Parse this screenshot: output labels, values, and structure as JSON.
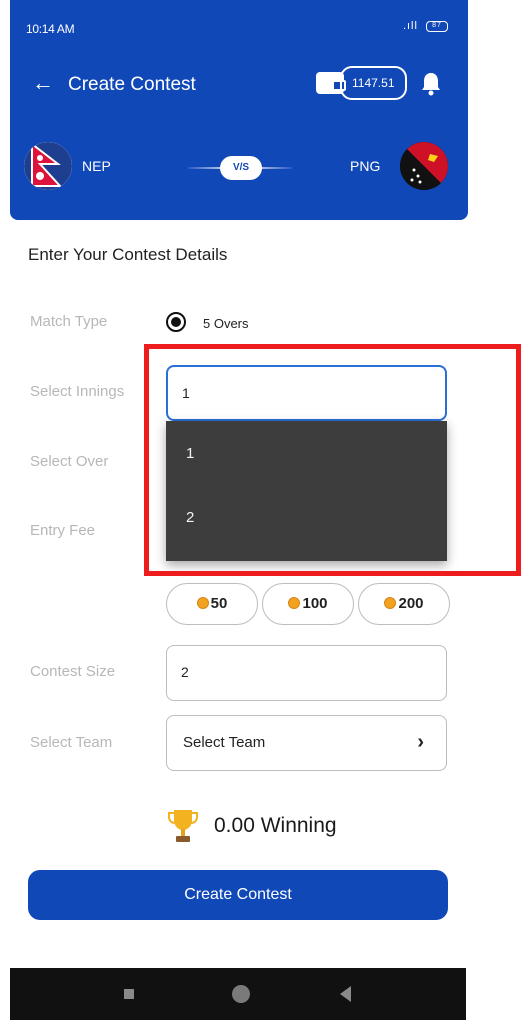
{
  "status_bar": {
    "time": "10:14 AM",
    "signal": ".ıll",
    "battery": "87"
  },
  "header": {
    "title": "Create Contest",
    "wallet_balance": "1147.51",
    "home_team": "NEP",
    "away_team": "PNG",
    "versus": "V/S"
  },
  "form": {
    "section_title": "Enter Your Contest Details",
    "labels": {
      "match_type": "Match Type",
      "select_innings": "Select Innings",
      "select_over": "Select Over",
      "entry_fee": "Entry Fee",
      "contest_size": "Contest Size",
      "select_team": "Select Team"
    },
    "match_type_option": "5 Overs",
    "innings_value": "1",
    "innings_options": [
      "1",
      "2"
    ],
    "entry_fee_chips": [
      "50",
      "100",
      "200"
    ],
    "contest_size_value": "2",
    "select_team_value": "Select Team",
    "winning_text": "0.00 Winning",
    "create_button": "Create Contest"
  },
  "colors": {
    "primary": "#1148b8",
    "highlight": "#ee1c1c",
    "dropdown_bg": "#3d3d3d",
    "coin": "#f1a21e"
  },
  "icons": [
    "back-arrow-icon",
    "wallet-icon",
    "bell-icon",
    "nepal-flag-icon",
    "png-flag-icon",
    "coin-icon",
    "chevron-right-icon",
    "trophy-icon"
  ]
}
